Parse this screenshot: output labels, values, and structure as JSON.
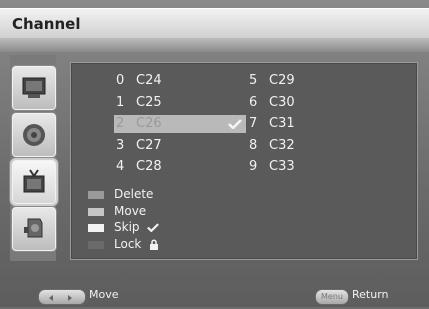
{
  "window": {
    "title": "Channel"
  },
  "nav": [
    {
      "name": "picture-icon"
    },
    {
      "name": "sound-icon"
    },
    {
      "name": "channel-icon"
    },
    {
      "name": "setup-icon"
    }
  ],
  "channels": [
    {
      "num": "0",
      "name": "C24",
      "selected": false,
      "skip": false
    },
    {
      "num": "1",
      "name": "C25",
      "selected": false,
      "skip": false
    },
    {
      "num": "2",
      "name": "C26",
      "selected": true,
      "skip": true
    },
    {
      "num": "3",
      "name": "C27",
      "selected": false,
      "skip": false
    },
    {
      "num": "4",
      "name": "C28",
      "selected": false,
      "skip": false
    },
    {
      "num": "5",
      "name": "C29",
      "selected": false,
      "skip": false
    },
    {
      "num": "6",
      "name": "C30",
      "selected": false,
      "skip": false
    },
    {
      "num": "7",
      "name": "C31",
      "selected": false,
      "skip": false
    },
    {
      "num": "8",
      "name": "C32",
      "selected": false,
      "skip": false
    },
    {
      "num": "9",
      "name": "C33",
      "selected": false,
      "skip": false
    }
  ],
  "legend": [
    {
      "label": "Delete",
      "color": "#9a9a9a",
      "icon": ""
    },
    {
      "label": "Move",
      "color": "#c6c6c6",
      "icon": ""
    },
    {
      "label": "Skip",
      "color": "#f2f2f2",
      "icon": "check-icon"
    },
    {
      "label": "Lock",
      "color": "#6a6a6a",
      "icon": "lock-icon"
    }
  ],
  "footer": {
    "move_label": "Move",
    "menu_button": "Menu",
    "return_label": "Return"
  }
}
